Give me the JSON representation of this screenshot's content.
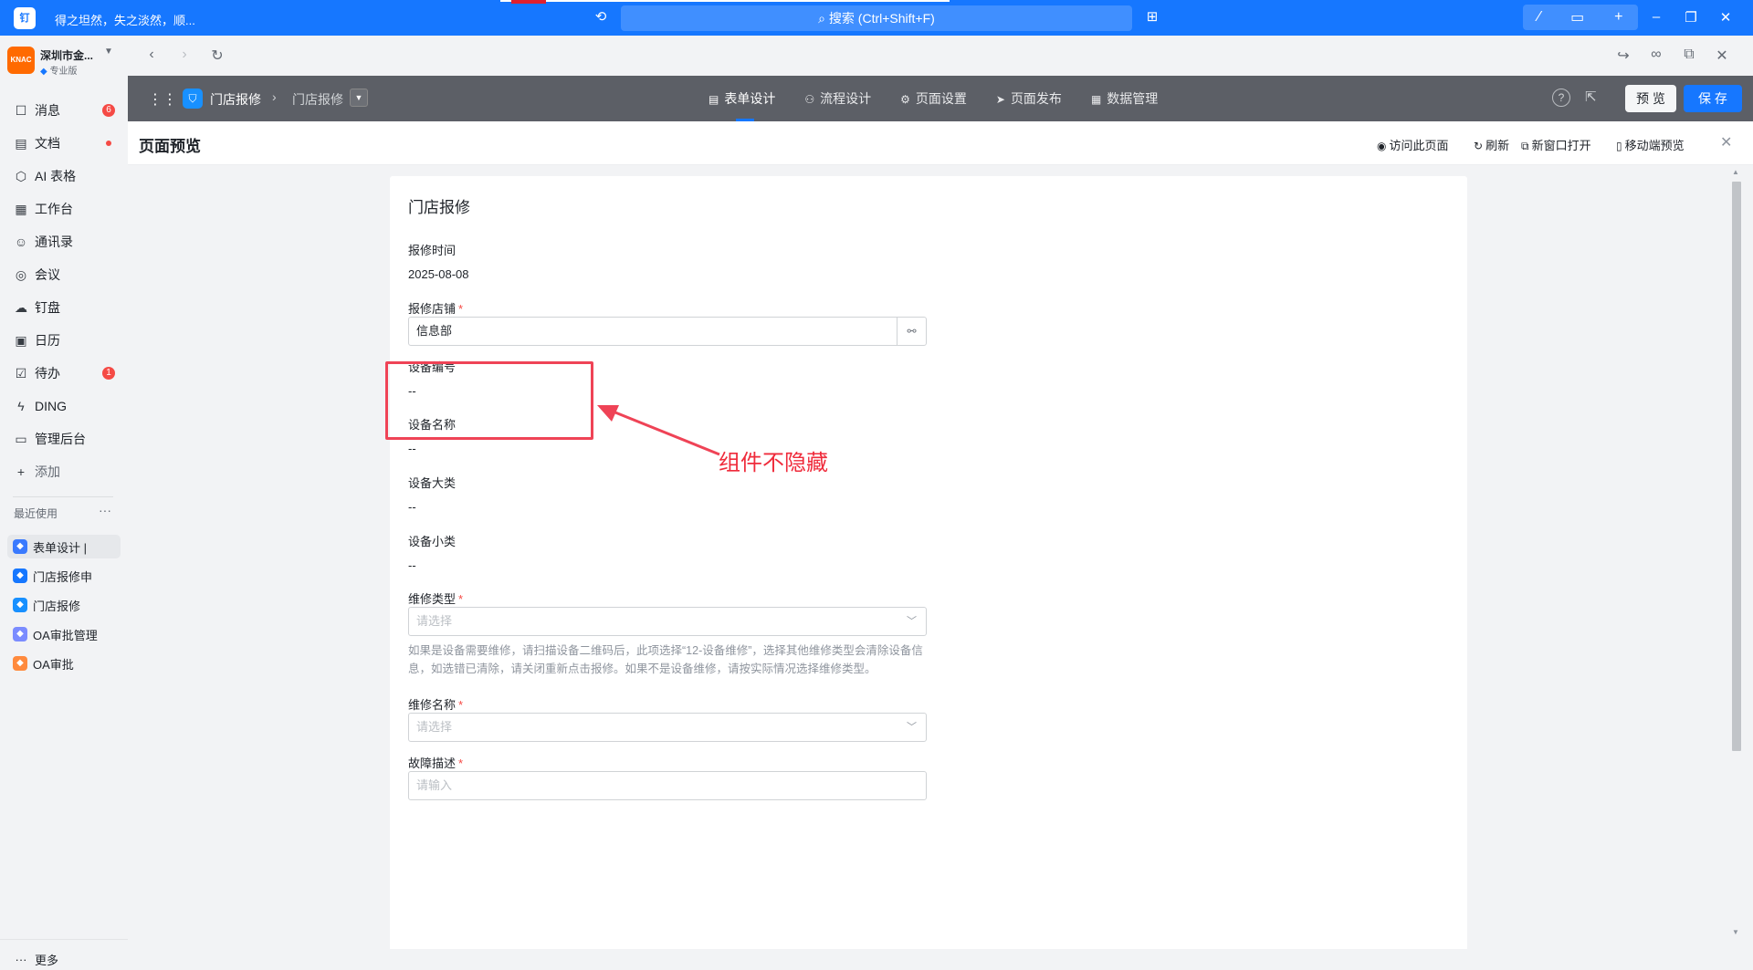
{
  "topbar": {
    "logo": "钉",
    "status": "得之坦然，失之淡然，顺...",
    "search_placeholder": "搜索 (Ctrl+Shift+F)"
  },
  "sidebar": {
    "org_name": "深圳市金...",
    "org_logo": "KNAC",
    "org_tag": "专业版",
    "items": [
      {
        "label": "消息",
        "icon": "message-icon",
        "glyph": "☐",
        "badge": "6"
      },
      {
        "label": "文档",
        "icon": "document-icon",
        "glyph": "▤",
        "dot": true
      },
      {
        "label": "AI 表格",
        "icon": "ai-table-icon",
        "glyph": "⬡"
      },
      {
        "label": "工作台",
        "icon": "workbench-icon",
        "glyph": "▦"
      },
      {
        "label": "通讯录",
        "icon": "contacts-icon",
        "glyph": "☺"
      },
      {
        "label": "会议",
        "icon": "meeting-icon",
        "glyph": "◎"
      },
      {
        "label": "钉盘",
        "icon": "cloud-disk-icon",
        "glyph": "☁"
      },
      {
        "label": "日历",
        "icon": "calendar-icon",
        "glyph": "▣"
      },
      {
        "label": "待办",
        "icon": "todo-icon",
        "glyph": "☑",
        "badge": "1"
      },
      {
        "label": "DING",
        "icon": "ding-icon",
        "glyph": "ϟ"
      },
      {
        "label": "管理后台",
        "icon": "admin-icon",
        "glyph": "▭"
      },
      {
        "label": "添加",
        "icon": "add-icon",
        "glyph": "+"
      }
    ],
    "recent_title": "最近使用",
    "recent": [
      {
        "label": "表单设计 | ",
        "color": "#3a7afe"
      },
      {
        "label": "门店报修申",
        "color": "#1677ff"
      },
      {
        "label": "门店报修",
        "color": "#1890ff"
      },
      {
        "label": "OA审批管理",
        "color": "#7b8cff"
      },
      {
        "label": "OA审批",
        "color": "#ff8a3d"
      }
    ],
    "more_label": "更多"
  },
  "apphead": {
    "app_name": "门店报修",
    "crumb_page": "门店报修",
    "tabs": [
      {
        "label": "表单设计",
        "icon": "form-icon",
        "glyph": "▤"
      },
      {
        "label": "流程设计",
        "icon": "flow-icon",
        "glyph": "⚇"
      },
      {
        "label": "页面设置",
        "icon": "settings-icon",
        "glyph": "⚙"
      },
      {
        "label": "页面发布",
        "icon": "publish-icon",
        "glyph": "➤"
      },
      {
        "label": "数据管理",
        "icon": "data-icon",
        "glyph": "▦"
      }
    ],
    "preview_label": "预 览",
    "save_label": "保 存"
  },
  "previewbar": {
    "title": "页面预览",
    "visit": "访问此页面",
    "refresh": "刷新",
    "new_window": "新窗口打开",
    "mobile": "移动端预览"
  },
  "form": {
    "title": "门店报修",
    "fields": {
      "repair_time_label": "报修时间",
      "repair_time_value": "2025-08-08",
      "store_label": "报修店铺",
      "store_value": "信息部",
      "equip_no_label": "设备编号",
      "equip_no_value": "--",
      "equip_name_label": "设备名称",
      "equip_name_value": "--",
      "equip_cat_label": "设备大类",
      "equip_cat_value": "--",
      "equip_sub_label": "设备小类",
      "equip_sub_value": "--",
      "repair_type_label": "维修类型",
      "repair_type_placeholder": "请选择",
      "repair_type_help": "如果是设备需要维修，请扫描设备二维码后，此项选择“12-设备维修”，选择其他维修类型会清除设备信息，如选错已清除，请关闭重新点击报修。如果不是设备维修，请按实际情况选择维修类型。",
      "repair_name_label": "维修名称",
      "repair_name_placeholder": "请选择",
      "fault_label": "故障描述",
      "fault_placeholder": "请输入"
    }
  },
  "annotation": {
    "text": "组件不隐藏",
    "color": "#ef2b3b"
  }
}
